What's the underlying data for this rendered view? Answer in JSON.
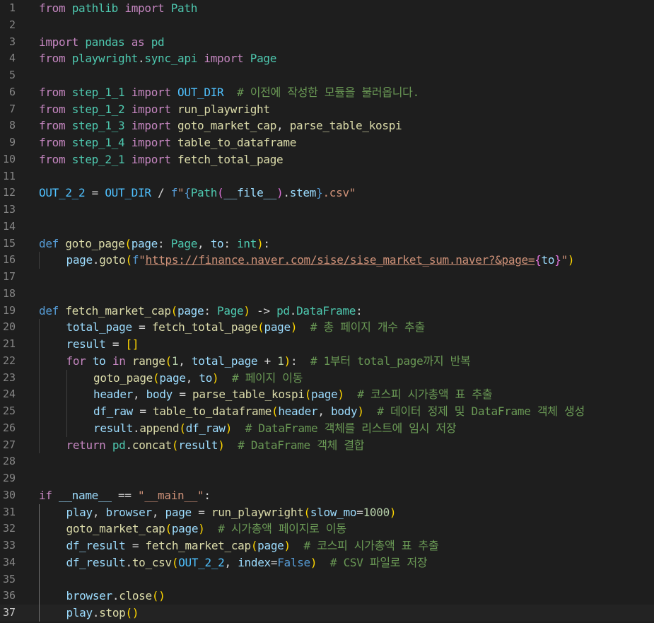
{
  "editor": {
    "language": "python",
    "active_line": 37,
    "lines": [
      {
        "n": "1",
        "indent": 0,
        "tokens": [
          [
            "kw",
            "from"
          ],
          [
            "p",
            " "
          ],
          [
            "cls",
            "pathlib"
          ],
          [
            "p",
            " "
          ],
          [
            "kw",
            "import"
          ],
          [
            "p",
            " "
          ],
          [
            "cls",
            "Path"
          ]
        ]
      },
      {
        "n": "2",
        "indent": 0,
        "tokens": []
      },
      {
        "n": "3",
        "indent": 0,
        "tokens": [
          [
            "kw",
            "import"
          ],
          [
            "p",
            " "
          ],
          [
            "cls",
            "pandas"
          ],
          [
            "p",
            " "
          ],
          [
            "kw",
            "as"
          ],
          [
            "p",
            " "
          ],
          [
            "cls",
            "pd"
          ]
        ]
      },
      {
        "n": "4",
        "indent": 0,
        "tokens": [
          [
            "kw",
            "from"
          ],
          [
            "p",
            " "
          ],
          [
            "cls",
            "playwright"
          ],
          [
            "p",
            "."
          ],
          [
            "cls",
            "sync_api"
          ],
          [
            "p",
            " "
          ],
          [
            "kw",
            "import"
          ],
          [
            "p",
            " "
          ],
          [
            "cls",
            "Page"
          ]
        ]
      },
      {
        "n": "5",
        "indent": 0,
        "tokens": []
      },
      {
        "n": "6",
        "indent": 0,
        "tokens": [
          [
            "kw",
            "from"
          ],
          [
            "p",
            " "
          ],
          [
            "cls",
            "step_1_1"
          ],
          [
            "p",
            " "
          ],
          [
            "kw",
            "import"
          ],
          [
            "p",
            " "
          ],
          [
            "con",
            "OUT_DIR"
          ],
          [
            "p",
            "  "
          ],
          [
            "cmt",
            "# 이전에 작성한 모듈을 불러옵니다."
          ]
        ]
      },
      {
        "n": "7",
        "indent": 0,
        "tokens": [
          [
            "kw",
            "from"
          ],
          [
            "p",
            " "
          ],
          [
            "cls",
            "step_1_2"
          ],
          [
            "p",
            " "
          ],
          [
            "kw",
            "import"
          ],
          [
            "p",
            " "
          ],
          [
            "fn",
            "run_playwright"
          ]
        ]
      },
      {
        "n": "8",
        "indent": 0,
        "tokens": [
          [
            "kw",
            "from"
          ],
          [
            "p",
            " "
          ],
          [
            "cls",
            "step_1_3"
          ],
          [
            "p",
            " "
          ],
          [
            "kw",
            "import"
          ],
          [
            "p",
            " "
          ],
          [
            "fn",
            "goto_market_cap"
          ],
          [
            "p",
            ", "
          ],
          [
            "fn",
            "parse_table_kospi"
          ]
        ]
      },
      {
        "n": "9",
        "indent": 0,
        "tokens": [
          [
            "kw",
            "from"
          ],
          [
            "p",
            " "
          ],
          [
            "cls",
            "step_1_4"
          ],
          [
            "p",
            " "
          ],
          [
            "kw",
            "import"
          ],
          [
            "p",
            " "
          ],
          [
            "fn",
            "table_to_dataframe"
          ]
        ]
      },
      {
        "n": "10",
        "indent": 0,
        "tokens": [
          [
            "kw",
            "from"
          ],
          [
            "p",
            " "
          ],
          [
            "cls",
            "step_2_1"
          ],
          [
            "p",
            " "
          ],
          [
            "kw",
            "import"
          ],
          [
            "p",
            " "
          ],
          [
            "fn",
            "fetch_total_page"
          ]
        ]
      },
      {
        "n": "11",
        "indent": 0,
        "tokens": []
      },
      {
        "n": "12",
        "indent": 0,
        "tokens": [
          [
            "con",
            "OUT_2_2"
          ],
          [
            "op",
            " = "
          ],
          [
            "con",
            "OUT_DIR"
          ],
          [
            "op",
            " / "
          ],
          [
            "kb",
            "f"
          ],
          [
            "str",
            "\""
          ],
          [
            "kb",
            "{"
          ],
          [
            "cls",
            "Path"
          ],
          [
            "b2",
            "("
          ],
          [
            "var",
            "__file__"
          ],
          [
            "b2",
            ")"
          ],
          [
            "p",
            "."
          ],
          [
            "var",
            "stem"
          ],
          [
            "kb",
            "}"
          ],
          [
            "str",
            ".csv\""
          ]
        ]
      },
      {
        "n": "13",
        "indent": 0,
        "tokens": []
      },
      {
        "n": "14",
        "indent": 0,
        "tokens": []
      },
      {
        "n": "15",
        "indent": 0,
        "tokens": [
          [
            "kb",
            "def"
          ],
          [
            "p",
            " "
          ],
          [
            "fn",
            "goto_page"
          ],
          [
            "b1",
            "("
          ],
          [
            "var",
            "page"
          ],
          [
            "p",
            ": "
          ],
          [
            "cls",
            "Page"
          ],
          [
            "p",
            ", "
          ],
          [
            "var",
            "to"
          ],
          [
            "p",
            ": "
          ],
          [
            "cls",
            "int"
          ],
          [
            "b1",
            ")"
          ],
          [
            "p",
            ":"
          ]
        ]
      },
      {
        "n": "16",
        "indent": 1,
        "tokens": [
          [
            "var",
            "page"
          ],
          [
            "p",
            "."
          ],
          [
            "fn",
            "goto"
          ],
          [
            "b1",
            "("
          ],
          [
            "kb",
            "f"
          ],
          [
            "str",
            "\""
          ],
          [
            "url",
            "https://finance.naver.com/sise/sise_market_sum.naver?&page="
          ],
          [
            "b2",
            "{"
          ],
          [
            "var",
            "to"
          ],
          [
            "b2",
            "}"
          ],
          [
            "str",
            "\""
          ],
          [
            "b1",
            ")"
          ]
        ]
      },
      {
        "n": "17",
        "indent": 0,
        "tokens": []
      },
      {
        "n": "18",
        "indent": 0,
        "tokens": []
      },
      {
        "n": "19",
        "indent": 0,
        "tokens": [
          [
            "kb",
            "def"
          ],
          [
            "p",
            " "
          ],
          [
            "fn",
            "fetch_market_cap"
          ],
          [
            "b1",
            "("
          ],
          [
            "var",
            "page"
          ],
          [
            "p",
            ": "
          ],
          [
            "cls",
            "Page"
          ],
          [
            "b1",
            ")"
          ],
          [
            "op",
            " -> "
          ],
          [
            "cls",
            "pd"
          ],
          [
            "p",
            "."
          ],
          [
            "cls",
            "DataFrame"
          ],
          [
            "p",
            ":"
          ]
        ]
      },
      {
        "n": "20",
        "indent": 1,
        "tokens": [
          [
            "var",
            "total_page"
          ],
          [
            "op",
            " = "
          ],
          [
            "fn",
            "fetch_total_page"
          ],
          [
            "b1",
            "("
          ],
          [
            "var",
            "page"
          ],
          [
            "b1",
            ")"
          ],
          [
            "p",
            "  "
          ],
          [
            "cmt",
            "# 총 페이지 개수 추출"
          ]
        ]
      },
      {
        "n": "21",
        "indent": 1,
        "tokens": [
          [
            "var",
            "result"
          ],
          [
            "op",
            " = "
          ],
          [
            "b1",
            "[]"
          ]
        ]
      },
      {
        "n": "22",
        "indent": 1,
        "tokens": [
          [
            "kw",
            "for"
          ],
          [
            "p",
            " "
          ],
          [
            "var",
            "to"
          ],
          [
            "p",
            " "
          ],
          [
            "kw",
            "in"
          ],
          [
            "p",
            " "
          ],
          [
            "fn",
            "range"
          ],
          [
            "b1",
            "("
          ],
          [
            "num",
            "1"
          ],
          [
            "p",
            ", "
          ],
          [
            "var",
            "total_page"
          ],
          [
            "op",
            " + "
          ],
          [
            "num",
            "1"
          ],
          [
            "b1",
            ")"
          ],
          [
            "p",
            ":  "
          ],
          [
            "cmt",
            "# 1부터 total_page까지 반복"
          ]
        ]
      },
      {
        "n": "23",
        "indent": 2,
        "tokens": [
          [
            "fn",
            "goto_page"
          ],
          [
            "b1",
            "("
          ],
          [
            "var",
            "page"
          ],
          [
            "p",
            ", "
          ],
          [
            "var",
            "to"
          ],
          [
            "b1",
            ")"
          ],
          [
            "p",
            "  "
          ],
          [
            "cmt",
            "# 페이지 이동"
          ]
        ]
      },
      {
        "n": "24",
        "indent": 2,
        "tokens": [
          [
            "var",
            "header"
          ],
          [
            "p",
            ", "
          ],
          [
            "var",
            "body"
          ],
          [
            "op",
            " = "
          ],
          [
            "fn",
            "parse_table_kospi"
          ],
          [
            "b1",
            "("
          ],
          [
            "var",
            "page"
          ],
          [
            "b1",
            ")"
          ],
          [
            "p",
            "  "
          ],
          [
            "cmt",
            "# 코스피 시가총액 표 추출"
          ]
        ]
      },
      {
        "n": "25",
        "indent": 2,
        "tokens": [
          [
            "var",
            "df_raw"
          ],
          [
            "op",
            " = "
          ],
          [
            "fn",
            "table_to_dataframe"
          ],
          [
            "b1",
            "("
          ],
          [
            "var",
            "header"
          ],
          [
            "p",
            ", "
          ],
          [
            "var",
            "body"
          ],
          [
            "b1",
            ")"
          ],
          [
            "p",
            "  "
          ],
          [
            "cmt",
            "# 데이터 정제 및 DataFrame 객체 생성"
          ]
        ]
      },
      {
        "n": "26",
        "indent": 2,
        "tokens": [
          [
            "var",
            "result"
          ],
          [
            "p",
            "."
          ],
          [
            "fn",
            "append"
          ],
          [
            "b1",
            "("
          ],
          [
            "var",
            "df_raw"
          ],
          [
            "b1",
            ")"
          ],
          [
            "p",
            "  "
          ],
          [
            "cmt",
            "# DataFrame 객체를 리스트에 임시 저장"
          ]
        ]
      },
      {
        "n": "27",
        "indent": 1,
        "tokens": [
          [
            "kw",
            "return"
          ],
          [
            "p",
            " "
          ],
          [
            "cls",
            "pd"
          ],
          [
            "p",
            "."
          ],
          [
            "fn",
            "concat"
          ],
          [
            "b1",
            "("
          ],
          [
            "var",
            "result"
          ],
          [
            "b1",
            ")"
          ],
          [
            "p",
            "  "
          ],
          [
            "cmt",
            "# DataFrame 객체 결합"
          ]
        ]
      },
      {
        "n": "28",
        "indent": 0,
        "tokens": []
      },
      {
        "n": "29",
        "indent": 0,
        "tokens": []
      },
      {
        "n": "30",
        "indent": 0,
        "tokens": [
          [
            "kw",
            "if"
          ],
          [
            "p",
            " "
          ],
          [
            "var",
            "__name__"
          ],
          [
            "op",
            " == "
          ],
          [
            "str",
            "\"__main__\""
          ],
          [
            "p",
            ":"
          ]
        ]
      },
      {
        "n": "31",
        "indent": 1,
        "tokens": [
          [
            "var",
            "play"
          ],
          [
            "p",
            ", "
          ],
          [
            "var",
            "browser"
          ],
          [
            "p",
            ", "
          ],
          [
            "var",
            "page"
          ],
          [
            "op",
            " = "
          ],
          [
            "fn",
            "run_playwright"
          ],
          [
            "b1",
            "("
          ],
          [
            "var",
            "slow_mo"
          ],
          [
            "op",
            "="
          ],
          [
            "num",
            "1000"
          ],
          [
            "b1",
            ")"
          ]
        ]
      },
      {
        "n": "32",
        "indent": 1,
        "tokens": [
          [
            "fn",
            "goto_market_cap"
          ],
          [
            "b1",
            "("
          ],
          [
            "var",
            "page"
          ],
          [
            "b1",
            ")"
          ],
          [
            "p",
            "  "
          ],
          [
            "cmt",
            "# 시가총액 페이지로 이동"
          ]
        ]
      },
      {
        "n": "33",
        "indent": 1,
        "tokens": [
          [
            "var",
            "df_result"
          ],
          [
            "op",
            " = "
          ],
          [
            "fn",
            "fetch_market_cap"
          ],
          [
            "b1",
            "("
          ],
          [
            "var",
            "page"
          ],
          [
            "b1",
            ")"
          ],
          [
            "p",
            "  "
          ],
          [
            "cmt",
            "# 코스피 시가총액 표 추출"
          ]
        ]
      },
      {
        "n": "34",
        "indent": 1,
        "tokens": [
          [
            "var",
            "df_result"
          ],
          [
            "p",
            "."
          ],
          [
            "fn",
            "to_csv"
          ],
          [
            "b1",
            "("
          ],
          [
            "con",
            "OUT_2_2"
          ],
          [
            "p",
            ", "
          ],
          [
            "var",
            "index"
          ],
          [
            "op",
            "="
          ],
          [
            "kb",
            "False"
          ],
          [
            "b1",
            ")"
          ],
          [
            "p",
            "  "
          ],
          [
            "cmt",
            "# CSV 파일로 저장"
          ]
        ]
      },
      {
        "n": "35",
        "indent": 1,
        "tokens": []
      },
      {
        "n": "36",
        "indent": 1,
        "tokens": [
          [
            "var",
            "browser"
          ],
          [
            "p",
            "."
          ],
          [
            "fn",
            "close"
          ],
          [
            "b1",
            "()"
          ]
        ]
      },
      {
        "n": "37",
        "indent": 1,
        "tokens": [
          [
            "var",
            "play"
          ],
          [
            "p",
            "."
          ],
          [
            "fn",
            "stop"
          ],
          [
            "b1",
            "()"
          ]
        ]
      }
    ]
  }
}
